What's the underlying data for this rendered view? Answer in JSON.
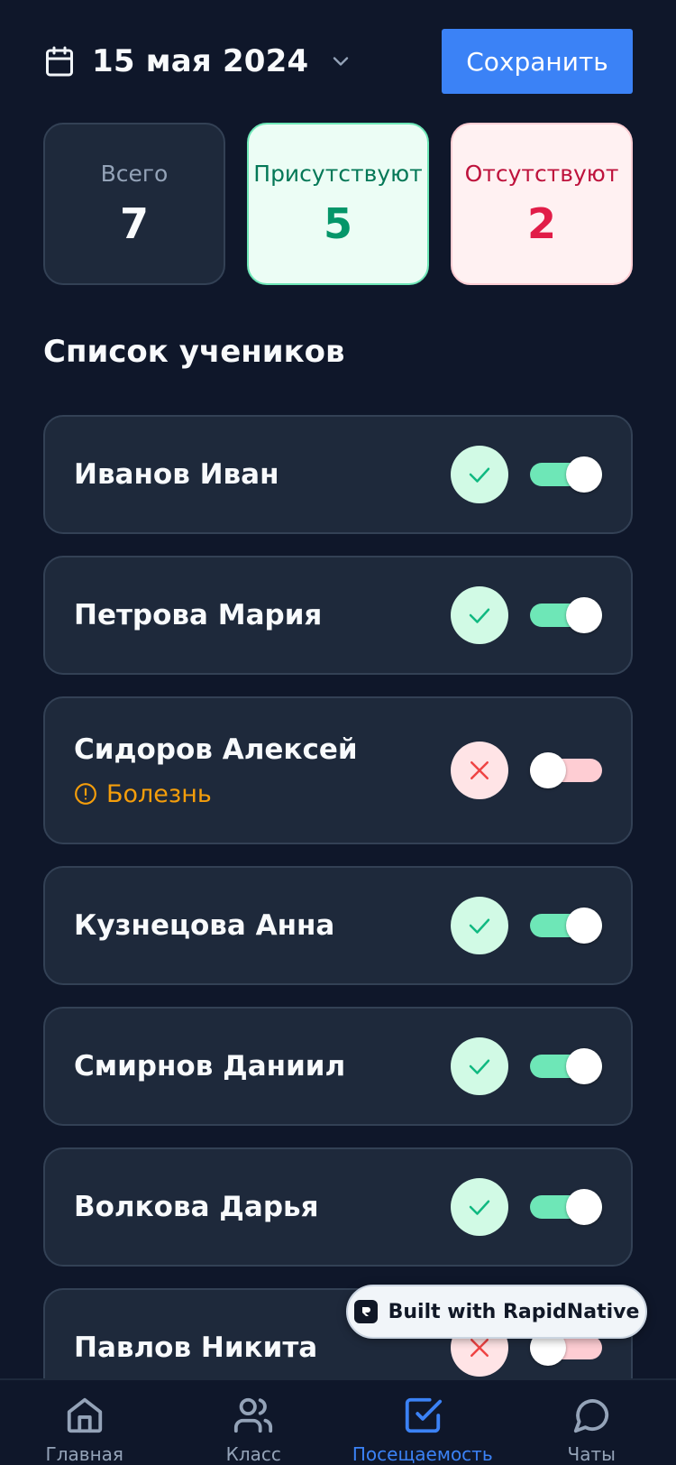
{
  "header": {
    "date": "15 мая 2024",
    "save_label": "Сохранить",
    "icons": {
      "calendar": "calendar-icon",
      "chevron": "chevron-down-icon"
    }
  },
  "stats": {
    "total": {
      "label": "Всего",
      "value": "7"
    },
    "present": {
      "label": "Присутствуют",
      "value": "5"
    },
    "absent": {
      "label": "Отсутствуют",
      "value": "2"
    }
  },
  "section_title": "Список учеников",
  "students": [
    {
      "name": "Иванов Иван",
      "present": true
    },
    {
      "name": "Петрова Мария",
      "present": true
    },
    {
      "name": "Сидоров Алексей",
      "present": false,
      "reason": "Болезнь"
    },
    {
      "name": "Кузнецова Анна",
      "present": true
    },
    {
      "name": "Смирнов Даниил",
      "present": true
    },
    {
      "name": "Волкова Дарья",
      "present": true
    },
    {
      "name": "Павлов Никита",
      "present": false
    }
  ],
  "badge": {
    "text": "Built with RapidNative"
  },
  "tabs": [
    {
      "label": "Главная",
      "icon": "home-icon",
      "active": false
    },
    {
      "label": "Класс",
      "icon": "users-icon",
      "active": false
    },
    {
      "label": "Посещаемость",
      "icon": "check-square-icon",
      "active": true
    },
    {
      "label": "Чаты",
      "icon": "chat-icon",
      "active": false
    }
  ],
  "colors": {
    "background": "#0f172a",
    "card": "#1e293b",
    "accent": "#3b82f6",
    "present": "#059669",
    "absent": "#e11d48",
    "warning": "#f59e0b"
  }
}
